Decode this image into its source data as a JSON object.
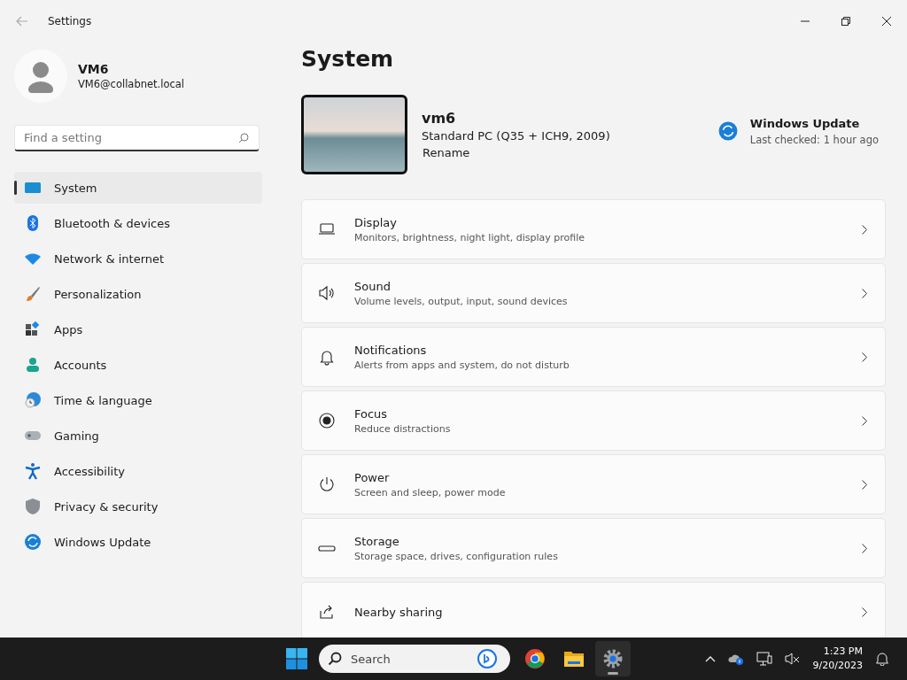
{
  "window": {
    "title": "Settings"
  },
  "account": {
    "name": "VM6",
    "email": "VM6@collabnet.local"
  },
  "search": {
    "placeholder": "Find a setting"
  },
  "sidebar": {
    "items": [
      {
        "label": "System",
        "selected": true
      },
      {
        "label": "Bluetooth & devices",
        "selected": false
      },
      {
        "label": "Network & internet",
        "selected": false
      },
      {
        "label": "Personalization",
        "selected": false
      },
      {
        "label": "Apps",
        "selected": false
      },
      {
        "label": "Accounts",
        "selected": false
      },
      {
        "label": "Time & language",
        "selected": false
      },
      {
        "label": "Gaming",
        "selected": false
      },
      {
        "label": "Accessibility",
        "selected": false
      },
      {
        "label": "Privacy & security",
        "selected": false
      },
      {
        "label": "Windows Update",
        "selected": false
      }
    ]
  },
  "page": {
    "title": "System"
  },
  "device": {
    "name": "vm6",
    "model": "Standard PC (Q35 + ICH9, 2009)",
    "rename": "Rename"
  },
  "update": {
    "title": "Windows Update",
    "status": "Last checked: 1 hour ago"
  },
  "settings": [
    {
      "title": "Display",
      "subtitle": "Monitors, brightness, night light, display profile"
    },
    {
      "title": "Sound",
      "subtitle": "Volume levels, output, input, sound devices"
    },
    {
      "title": "Notifications",
      "subtitle": "Alerts from apps and system, do not disturb"
    },
    {
      "title": "Focus",
      "subtitle": "Reduce distractions"
    },
    {
      "title": "Power",
      "subtitle": "Screen and sleep, power mode"
    },
    {
      "title": "Storage",
      "subtitle": "Storage space, drives, configuration rules"
    },
    {
      "title": "Nearby sharing"
    }
  ],
  "taskbar": {
    "search": "Search",
    "apps": [
      {
        "selected": false
      },
      {
        "selected": false
      },
      {
        "selected": true
      }
    ],
    "time": "1:23 PM",
    "date": "9/20/2023"
  }
}
